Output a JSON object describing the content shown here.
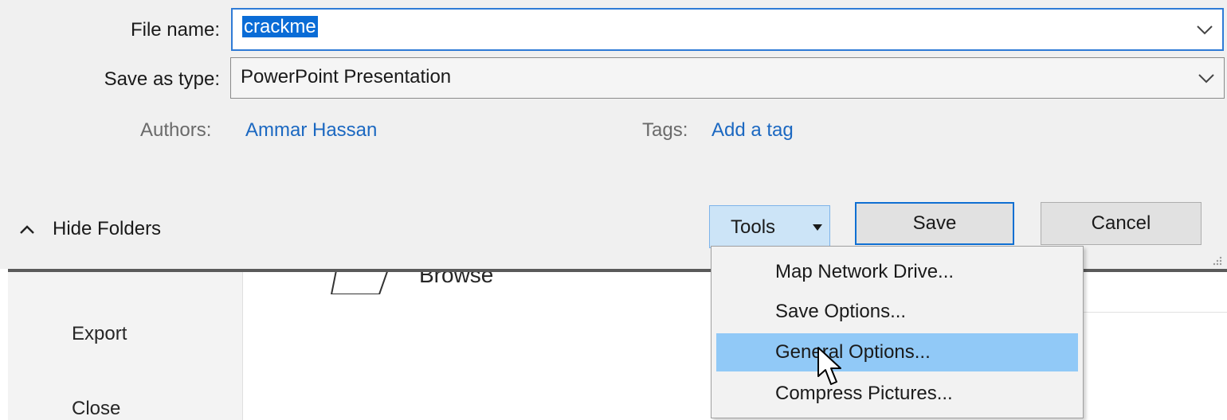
{
  "save_form": {
    "file_name_label": "File name:",
    "file_name_value": "crackme",
    "save_as_type_label": "Save as type:",
    "save_as_type_value": "PowerPoint Presentation",
    "authors_label": "Authors:",
    "authors_value": "Ammar Hassan",
    "tags_label": "Tags:",
    "tags_value": "Add a tag"
  },
  "footer": {
    "hide_folders_label": "Hide Folders",
    "tools_label": "Tools",
    "save_label": "Save",
    "cancel_label": "Cancel"
  },
  "tools_menu": {
    "items": [
      "Map Network Drive...",
      "Save Options...",
      "General Options...",
      "Compress Pictures..."
    ],
    "highlighted": "General Options..."
  },
  "backstage": {
    "sidebar_items": [
      "Export",
      "Close"
    ],
    "browse_label": "Browse"
  },
  "colors": {
    "dialog_bg": "#f0f0f0",
    "accent": "#0a6cd6",
    "link": "#1b68c1",
    "menu_highlight": "#91c9f7"
  }
}
